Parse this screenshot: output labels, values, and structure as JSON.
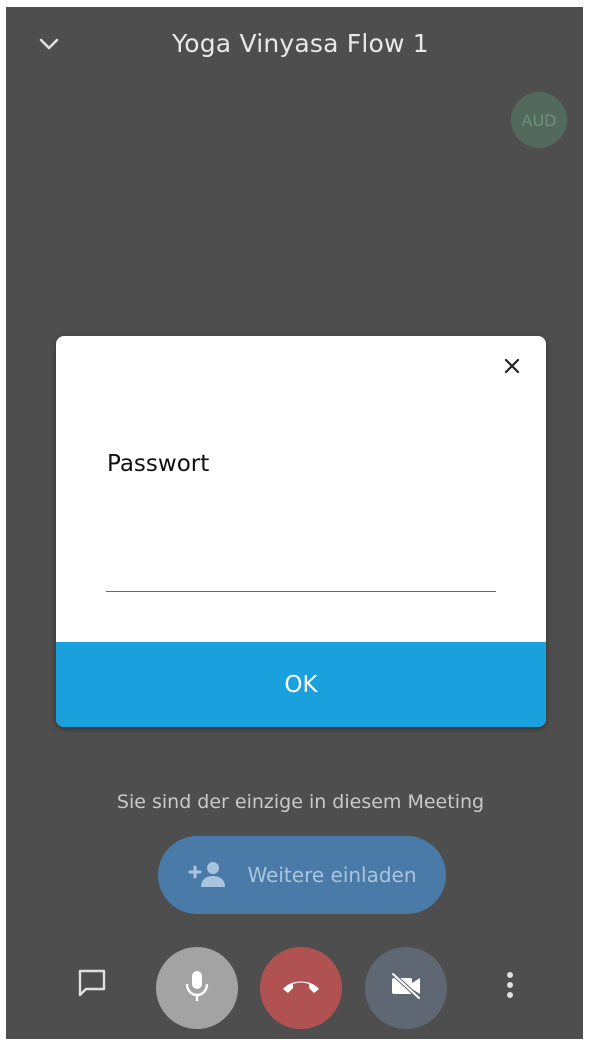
{
  "header": {
    "title": "Yoga Vinyasa Flow 1",
    "collapse_icon": "chevron-down-icon"
  },
  "participant": {
    "avatar_label": "AUD"
  },
  "dialog": {
    "label": "Passwort",
    "input_value": "",
    "ok_label": "OK",
    "close_icon": "close-icon"
  },
  "meeting": {
    "only_message": "Sie sind der einzige in diesem Meeting",
    "invite_label": "Weitere einladen",
    "invite_icon": "add-person-icon"
  },
  "toolbar": {
    "chat_icon": "chat-icon",
    "mic_icon": "microphone-icon",
    "hangup_icon": "hangup-icon",
    "video_icon": "video-off-icon",
    "more_icon": "more-vertical-icon"
  },
  "colors": {
    "background": "#4e4e4e",
    "accent": "#19a0dd",
    "hangup": "#b15252",
    "invite": "#4a7ba8"
  }
}
